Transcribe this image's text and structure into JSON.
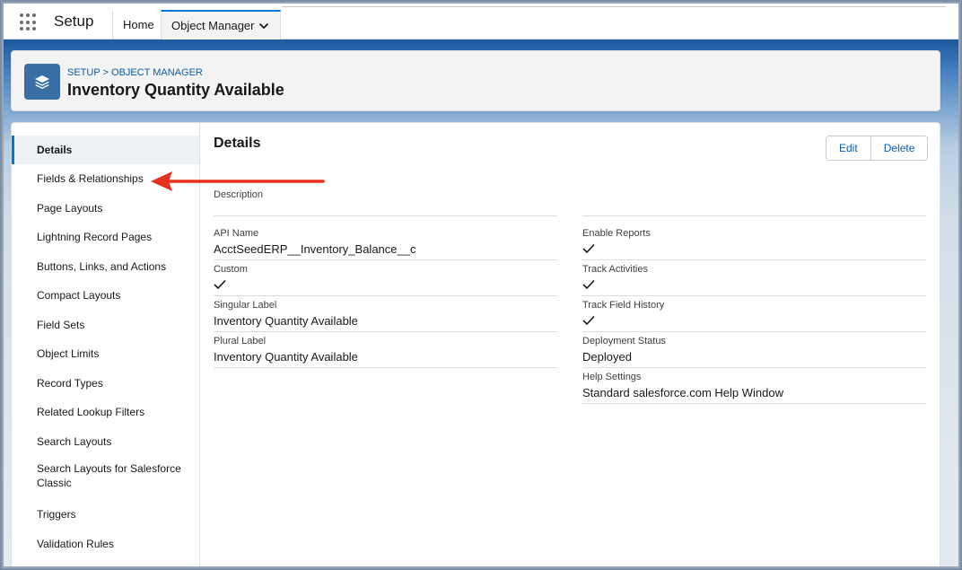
{
  "global_header": {
    "app_name": "Setup",
    "tabs": [
      {
        "label": "Home"
      },
      {
        "label": "Object Manager"
      }
    ]
  },
  "object_header": {
    "breadcrumb": "SETUP > OBJECT MANAGER",
    "title": "Inventory Quantity Available",
    "icon": "layers-icon"
  },
  "sidebar": {
    "items": [
      {
        "label": "Details",
        "active": true
      },
      {
        "label": "Fields & Relationships"
      },
      {
        "label": "Page Layouts"
      },
      {
        "label": "Lightning Record Pages"
      },
      {
        "label": "Buttons, Links, and Actions"
      },
      {
        "label": "Compact Layouts"
      },
      {
        "label": "Field Sets"
      },
      {
        "label": "Object Limits"
      },
      {
        "label": "Record Types"
      },
      {
        "label": "Related Lookup Filters"
      },
      {
        "label": "Search Layouts"
      },
      {
        "label": "Search Layouts for Salesforce Classic"
      },
      {
        "label": "Triggers"
      },
      {
        "label": "Validation Rules"
      }
    ]
  },
  "details": {
    "title": "Details",
    "edit_label": "Edit",
    "delete_label": "Delete",
    "description_label": "Description",
    "left_fields": [
      {
        "label": "API Name",
        "value": "AcctSeedERP__Inventory_Balance__c"
      },
      {
        "label": "Custom",
        "checked": true
      },
      {
        "label": "Singular Label",
        "value": "Inventory Quantity Available"
      },
      {
        "label": "Plural Label",
        "value": "Inventory Quantity Available"
      }
    ],
    "right_fields": [
      {
        "label": "Enable Reports",
        "checked": true
      },
      {
        "label": "Track Activities",
        "checked": true
      },
      {
        "label": "Track Field History",
        "checked": true
      },
      {
        "label": "Deployment Status",
        "value": "Deployed"
      },
      {
        "label": "Help Settings",
        "value": "Standard salesforce.com Help Window"
      }
    ]
  },
  "colors": {
    "brand_blue": "#0176d3",
    "link_blue": "#0b5cab",
    "annotation_red": "#e8321f"
  }
}
